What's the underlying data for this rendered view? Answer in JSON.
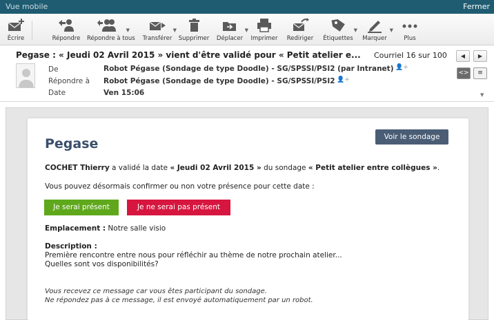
{
  "topbar": {
    "title": "Vue mobile",
    "close": "Fermer"
  },
  "toolbar": {
    "compose": "Écrire",
    "reply": "Répondre",
    "reply_all": "Répondre à tous",
    "forward": "Transférer",
    "delete": "Supprimer",
    "move": "Déplacer",
    "print": "Imprimer",
    "redirect": "Rediriger",
    "tags": "Étiquettes",
    "mark": "Marquer",
    "more": "Plus"
  },
  "header": {
    "subject": "Pegase : « Jeudi 02 Avril 2015 » vient d'être validé pour « Petit atelier e...",
    "counter": "Courriel 16 sur 100",
    "from_label": "De",
    "from_value": "Robot Pégase (Sondage de type Doodle) - SG/SPSSI/PSI2 (par Intranet)",
    "replyto_label": "Répondre à",
    "replyto_value": "Robot Pégase (Sondage de type Doodle) - SG/SPSSI/PSI2",
    "date_label": "Date",
    "date_value": "Ven 15:06",
    "prev_glyph": "◀",
    "next_glyph": "▶",
    "html_view_glyph": "<>",
    "text_view_glyph": "≡",
    "expand_glyph": "▼"
  },
  "message": {
    "title": "Pegase",
    "survey_button": "Voir le sondage",
    "line1": {
      "name": "COCHET Thierry",
      "text1": " a validé la date ",
      "date": "« Jeudi 02 Avril 2015 »",
      "text2": " du sondage ",
      "survey": "« Petit atelier entre collègues »",
      "text3": "."
    },
    "line2": "Vous pouvez désormais confirmer ou non votre présence pour cette date :",
    "btn_yes": "Je serai présent",
    "btn_no": "Je ne serai pas présent",
    "location_label": "Emplacement :",
    "location_value": " Notre salle visio",
    "description_label": "Description :",
    "description_1": "Première rencontre entre nous pour réfléchir au thème de notre prochain atelier...",
    "description_2": "Quelles sont vos disponibilités?",
    "footer_1": "Vous recevez ce message car vous êtes participant du sondage.",
    "footer_2": "Ne répondez pas à ce message, il est envoyé automatiquement par un robot."
  },
  "colors": {
    "topbar": "#1f5c72",
    "survey_button": "#4a5d75",
    "yes_button": "#5fa81c",
    "no_button": "#d6163f",
    "title": "#3a4f6b"
  },
  "icons": [
    "compose-icon",
    "reply-icon",
    "reply-all-icon",
    "forward-icon",
    "trash-icon",
    "move-folder-icon",
    "printer-icon",
    "redirect-icon",
    "tag-icon",
    "pen-icon",
    "more-icon",
    "add-contact-icon",
    "avatar-icon"
  ]
}
